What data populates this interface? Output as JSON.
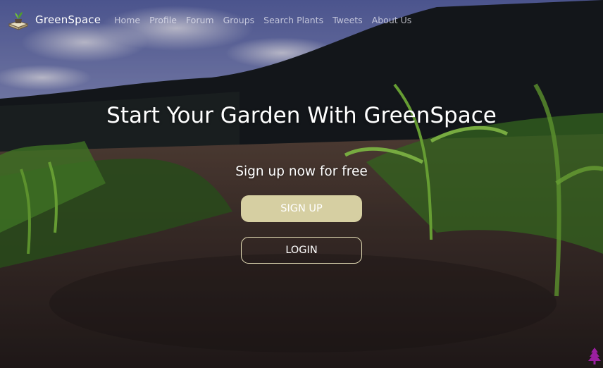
{
  "brand": {
    "name": "GreenSpace",
    "logo_icon": "plant-pot-book-icon"
  },
  "nav": {
    "items": [
      {
        "label": "Home"
      },
      {
        "label": "Profile"
      },
      {
        "label": "Forum"
      },
      {
        "label": "Groups"
      },
      {
        "label": "Search Plants"
      },
      {
        "label": "Tweets"
      },
      {
        "label": "About Us"
      }
    ]
  },
  "hero": {
    "title": "Start Your Garden With GreenSpace",
    "subtitle": "Sign up now for free",
    "signup_label": "SIGN UP",
    "login_label": "LOGIN"
  },
  "colors": {
    "signup_button": "#d6cfa2",
    "login_border": "#e6dfb8",
    "corner_icon": "#9a1fa0"
  },
  "corner": {
    "icon": "tree-icon"
  }
}
